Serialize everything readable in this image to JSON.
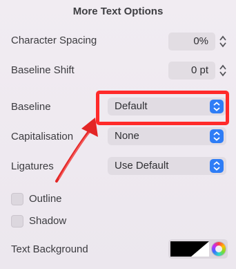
{
  "panel": {
    "title": "More Text Options",
    "character_spacing": {
      "label": "Character Spacing",
      "value": "0%"
    },
    "baseline_shift": {
      "label": "Baseline Shift",
      "value": "0 pt"
    },
    "baseline": {
      "label": "Baseline",
      "value": "Default"
    },
    "capitalisation": {
      "label": "Capitalisation",
      "value": "None"
    },
    "ligatures": {
      "label": "Ligatures",
      "value": "Use Default"
    },
    "outline": {
      "label": "Outline",
      "checked": false
    },
    "shadow": {
      "label": "Shadow",
      "checked": false
    },
    "text_background": {
      "label": "Text Background",
      "color": "#000000"
    }
  },
  "colors": {
    "accent": "#2f7df6",
    "annotation": "#ff2a2a"
  },
  "icons": [
    "stepper-icon",
    "popup-chevron-icon",
    "color-wheel-icon",
    "annotation-arrow-icon"
  ]
}
